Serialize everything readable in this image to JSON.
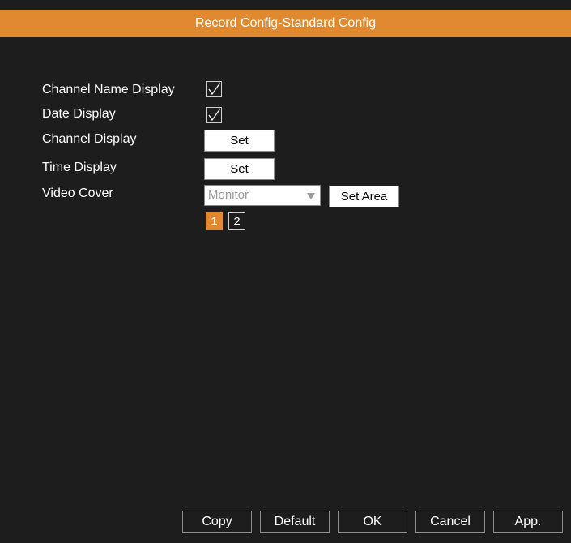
{
  "window": {
    "title": "Record Config-Standard Config",
    "accent_color": "#e0892f"
  },
  "settings": {
    "channel_name_display": {
      "label": "Channel Name Display",
      "checked": true
    },
    "date_display": {
      "label": "Date Display",
      "checked": true
    },
    "channel_display": {
      "label": "Channel Display",
      "button": "Set"
    },
    "time_display": {
      "label": "Time Display",
      "button": "Set"
    },
    "video_cover": {
      "label": "Video Cover",
      "selected": "Monitor",
      "set_area_button": "Set Area"
    }
  },
  "pagination": {
    "pages": [
      "1",
      "2"
    ],
    "current": "1"
  },
  "footer": {
    "copy": "Copy",
    "default": "Default",
    "ok": "OK",
    "cancel": "Cancel",
    "apply": "App."
  }
}
